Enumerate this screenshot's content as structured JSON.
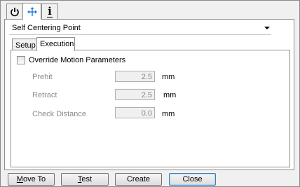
{
  "tabs": [
    {
      "icon": "power-icon"
    },
    {
      "icon": "move-arrows-icon"
    },
    {
      "icon": "info-icon",
      "glyph": "i"
    }
  ],
  "operation": {
    "selected": "Self Centering Point"
  },
  "subtabs": [
    "Setup",
    "Execution"
  ],
  "execution": {
    "override_label": "Override Motion Parameters",
    "override_checked": false,
    "params": [
      {
        "label": "Prehit",
        "value": "2.5",
        "unit": "mm"
      },
      {
        "label": "Retract",
        "value": "2.5",
        "unit": "mm"
      },
      {
        "label": "Check Distance",
        "value": "0.0",
        "unit": "mm"
      }
    ]
  },
  "buttons": {
    "move_to": {
      "accel": "M",
      "rest": "ove To"
    },
    "test": {
      "accel": "T",
      "rest": "est"
    },
    "create": "Create",
    "close": "Close"
  },
  "colors": {
    "accent": "#3c7fb1",
    "move_icon": "#1e7bd6"
  }
}
